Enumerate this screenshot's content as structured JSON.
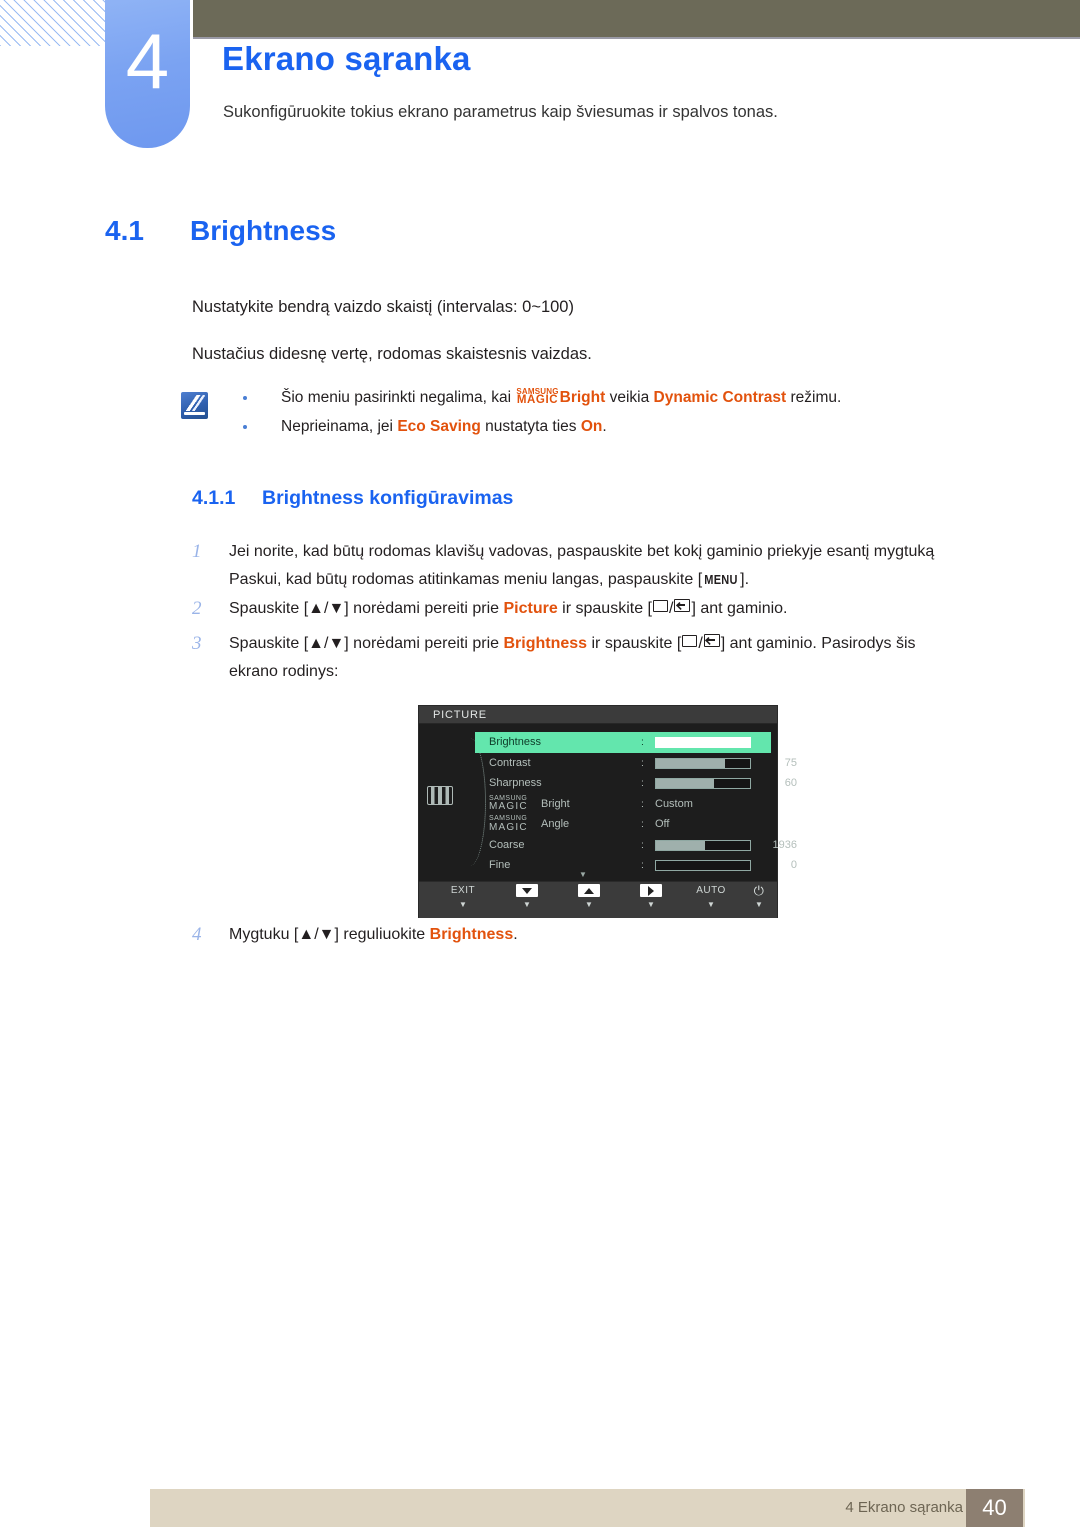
{
  "chapter": {
    "number": "4",
    "title": "Ekrano sąranka",
    "subtitle": "Sukonfigūruokite tokius ekrano parametrus kaip šviesumas ir spalvos tonas."
  },
  "section": {
    "number": "4.1",
    "title": "Brightness"
  },
  "paragraphs": {
    "p1": "Nustatykite bendrą vaizdo skaistį (intervalas: 0~100)",
    "p2": "Nustačius didesnę vertę, rodomas skaistesnis vaizdas."
  },
  "note": {
    "icon": "note-pen-icon",
    "items": [
      {
        "before": "Šio meniu pasirinkti negalima, kai ",
        "magic_top": "SAMSUNG",
        "magic_bottom": "MAGIC",
        "magic_suffix": "Bright",
        "middle": " veikia ",
        "highlight": "Dynamic Contrast",
        "after": " režimu."
      },
      {
        "before": "Neprieinama, jei ",
        "highlight": "Eco Saving",
        "middle": " nustatyta ties ",
        "highlight2": "On",
        "after": "."
      }
    ]
  },
  "subsection": {
    "number": "4.1.1",
    "title": "Brightness konfigūravimas"
  },
  "steps": [
    {
      "index": "1",
      "line1": "Jei norite, kad būtų rodomas klavišų vadovas, paspauskite bet kokį gaminio priekyje esantį mygtuką",
      "line2_before": "Paskui, kad būtų rodomas atitinkamas meniu langas, paspauskite [",
      "key": "MENU",
      "line2_after": "]."
    },
    {
      "index": "2",
      "before": "Spauskite [▲/▼] norėdami pereiti prie ",
      "highlight": "Picture",
      "middle": " ir spauskite [",
      "after": "] ant gaminio."
    },
    {
      "index": "3",
      "before": "Spauskite [▲/▼] norėdami pereiti prie ",
      "highlight": "Brightness",
      "middle": " ir spauskite [",
      "after": "] ant gaminio. Pasirodys šis",
      "line2": "ekrano rodinys:"
    },
    {
      "index": "4",
      "before": "Mygtuku [▲/▼] reguliuokite ",
      "highlight": "Brightness",
      "after": "."
    }
  ],
  "osd": {
    "title": "PICTURE",
    "left_icon": "picture-bars-icon",
    "rows": [
      {
        "label": "Brightness",
        "type": "slider",
        "value": "100",
        "fill": 100,
        "selected": true
      },
      {
        "label": "Contrast",
        "type": "slider",
        "value": "75",
        "fill": 73,
        "selected": false
      },
      {
        "label": "Sharpness",
        "type": "slider",
        "value": "60",
        "fill": 62,
        "selected": false
      },
      {
        "label": "Bright",
        "type": "magic-option",
        "magic_top": "SAMSUNG",
        "magic_bottom": "MAGIC",
        "value": "Custom",
        "selected": false
      },
      {
        "label": "Angle",
        "type": "magic-option",
        "magic_top": "SAMSUNG",
        "magic_bottom": "MAGIC",
        "value": "Off",
        "selected": false
      },
      {
        "label": "Coarse",
        "type": "slider",
        "value": "1936",
        "fill": 52,
        "selected": false
      },
      {
        "label": "Fine",
        "type": "slider",
        "value": "0",
        "fill": 0,
        "selected": false
      }
    ],
    "more_indicator": "▼",
    "footer_buttons": [
      {
        "caption": "EXIT",
        "kind": "text",
        "tick": "▼"
      },
      {
        "caption": "",
        "kind": "down",
        "tick": "▼"
      },
      {
        "caption": "",
        "kind": "up",
        "tick": "▼"
      },
      {
        "caption": "",
        "kind": "right",
        "tick": "▼"
      },
      {
        "caption": "AUTO",
        "kind": "text",
        "tick": "▼"
      },
      {
        "caption": "⏻",
        "kind": "power",
        "tick": "▼"
      }
    ]
  },
  "footer": {
    "text": "4 Ekrano sąranka",
    "page": "40"
  },
  "colors": {
    "accent_blue": "#1a63f0",
    "tab_blue": "#7ba3f2",
    "highlight_orange": "#e2520d",
    "olive": "#6c6a58",
    "footer_beige": "#ded5c2",
    "page_box": "#8d7f71",
    "osd_green": "#63e6ad"
  }
}
